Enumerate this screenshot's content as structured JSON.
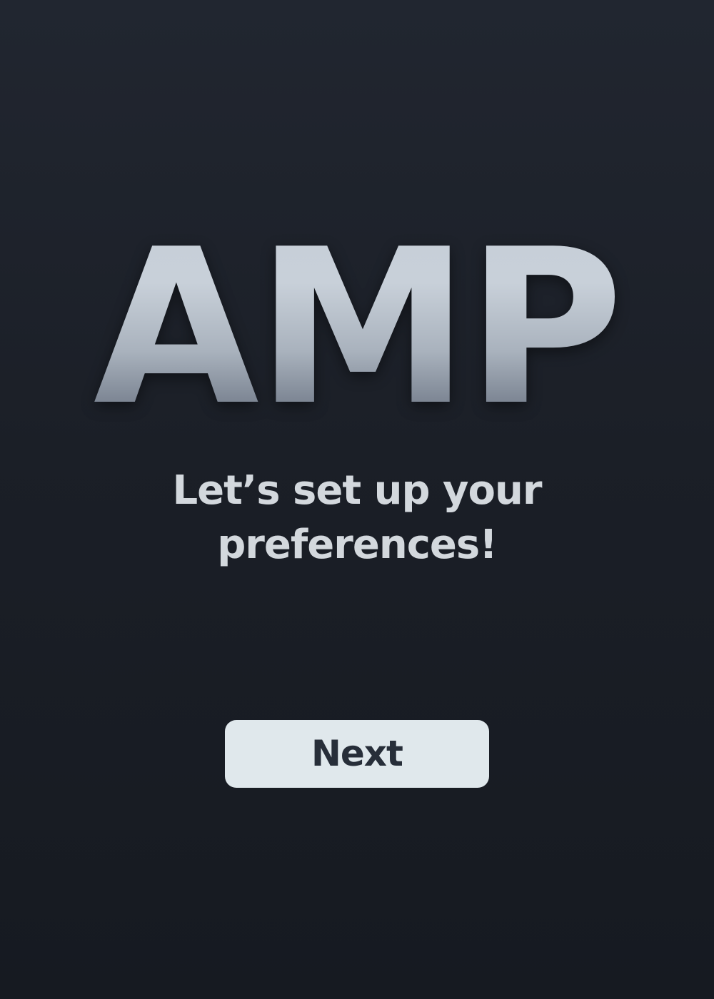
{
  "welcome": {
    "logo_text": "AMP",
    "subtitle_line1": "Let’s set up your",
    "subtitle_line2": "preferences!",
    "next_label": "Next"
  },
  "colors": {
    "background_top": "#212630",
    "background_bottom": "#161a21",
    "text_light": "#d3d8dd",
    "button_bg": "#e0e8ec",
    "button_text": "#272e39"
  }
}
